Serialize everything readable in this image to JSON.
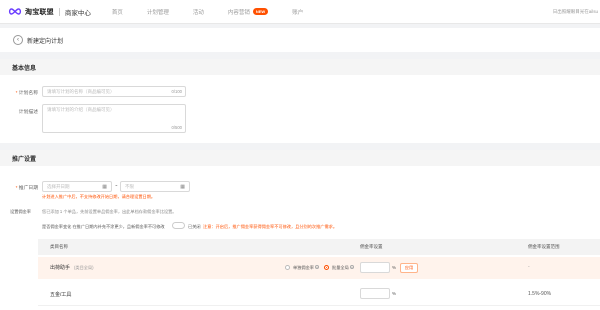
{
  "header": {
    "brand": "淘宝联盟",
    "subbrand": "商家中心",
    "nav": [
      "首页",
      "计划管理",
      "活动",
      "内容营销",
      "账户"
    ],
    "nav_badge": "NEW",
    "user_info": "日出照耀眼目光在ailsu"
  },
  "page": {
    "title": "新建定向计划",
    "back_icon": "arrow-left-icon"
  },
  "basic_info": {
    "section_title": "基本信息",
    "plan_name_label": "计划名称",
    "plan_name_placeholder": "请填写计划的名称（商品编可见）",
    "plan_name_counter": "0/100",
    "plan_desc_label": "计划描述",
    "plan_desc_placeholder": "请填写计划的介绍（商品编可见）",
    "plan_desc_counter": "0/500"
  },
  "promo_settings": {
    "section_title": "推广设置",
    "date_label": "推广日期",
    "date_start_placeholder": "选择开日期",
    "date_sep": "~",
    "date_end_placeholder": "不限",
    "date_tip": "计划进入推广中后，不支持修改开始日期，请合理设置日期。",
    "commission_label": "设置佣金率",
    "commission_note": "您已添加 1 个单品，先前设置单品佣金率，出此单档存款佣金率比设置。",
    "rule_text": "是否佣金率变化 在推广日期内补充不涂更少，且新佣金率不可修改",
    "toggle_state": "已关闭",
    "rule_tip": "注意：开启后，推广佣金率获得佣金率不可修改，且分别的次推广需求。",
    "table": {
      "headers": [
        "类目名称",
        "佣金率设置",
        "佣金率设置范围"
      ],
      "rows": [
        {
          "name": "出荷助手",
          "tag": "(类目全局)",
          "option_a": "单独佣金率",
          "option_b": "批量全局",
          "apply": "应用",
          "range": "-"
        },
        {
          "name": "五金/工具",
          "range": "1.5%-90%"
        }
      ],
      "pct_symbol": "%"
    }
  }
}
